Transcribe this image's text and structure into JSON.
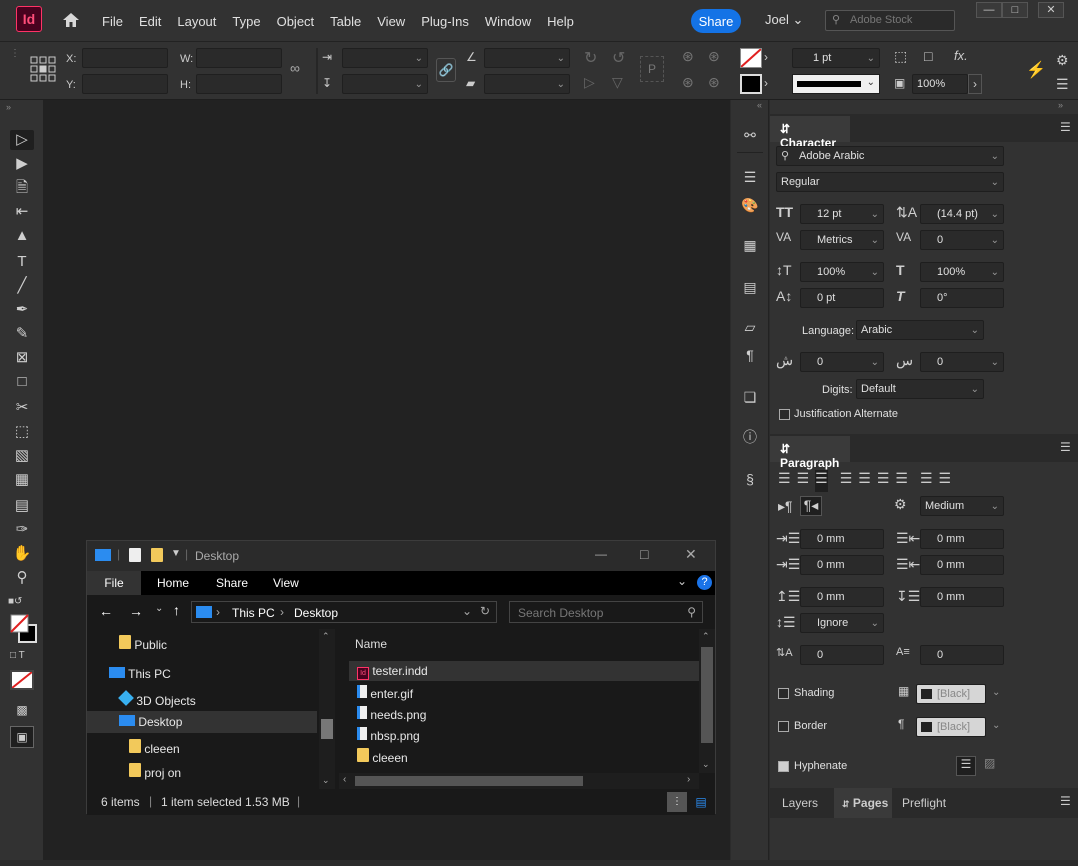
{
  "app": {
    "icon_text": "Id",
    "user": "Joel",
    "share_label": "Share",
    "stock_placeholder": "Adobe Stock"
  },
  "menu": [
    "File",
    "Edit",
    "Layout",
    "Type",
    "Object",
    "Table",
    "View",
    "Plug-Ins",
    "Window",
    "Help"
  ],
  "control_bar": {
    "x_label": "X:",
    "y_label": "Y:",
    "w_label": "W:",
    "h_label": "H:",
    "stroke_weight": "1 pt",
    "opacity": "100%"
  },
  "explorer": {
    "title": "Desktop",
    "ribbon_tabs": [
      "File",
      "Home",
      "Share",
      "View"
    ],
    "breadcrumb": [
      "This PC",
      "Desktop"
    ],
    "search_placeholder": "Search Desktop",
    "column_name": "Name",
    "tree": [
      {
        "label": "Public",
        "type": "folder"
      },
      {
        "label": "This PC",
        "type": "pc"
      },
      {
        "label": "3D Objects",
        "type": "objects"
      },
      {
        "label": "Desktop",
        "type": "desktop",
        "selected": true
      },
      {
        "label": "cleeen",
        "type": "folder"
      },
      {
        "label": "proj on",
        "type": "folder"
      }
    ],
    "files": [
      {
        "name": "tester.indd",
        "type": "indd",
        "selected": true
      },
      {
        "name": "enter.gif",
        "type": "img"
      },
      {
        "name": "needs.png",
        "type": "img"
      },
      {
        "name": "nbsp.png",
        "type": "img"
      },
      {
        "name": "cleeen",
        "type": "folder"
      }
    ],
    "status_count": "6 items",
    "status_selected": "1 item selected  1.53 MB"
  },
  "character": {
    "tab": "Character",
    "font_family": "Adobe Arabic",
    "font_style": "Regular",
    "font_size": "12 pt",
    "leading": "(14.4 pt)",
    "kerning": "Metrics",
    "tracking": "0",
    "vertical_scale": "100%",
    "horizontal_scale": "100%",
    "baseline_shift": "0 pt",
    "skew": "0°",
    "language_label": "Language:",
    "language": "Arabic",
    "diacritic1": "0",
    "diacritic2": "0",
    "digits_label": "Digits:",
    "digits": "Default",
    "justification_alternate": "Justification Alternate"
  },
  "paragraph": {
    "tab": "Paragraph",
    "kashida": "Medium",
    "left_indent": "0 mm",
    "right_indent": "0 mm",
    "first_line_indent": "0 mm",
    "last_line_indent": "0 mm",
    "space_before": "0 mm",
    "space_after": "0 mm",
    "align_to_grid": "Ignore",
    "drop_cap_lines": "0",
    "drop_cap_chars": "0",
    "shading_label": "Shading",
    "shading_color": "[Black]",
    "border_label": "Border",
    "border_color": "[Black]",
    "hyphenate_label": "Hyphenate"
  },
  "bottom_tabs": [
    "Layers",
    "Pages",
    "Preflight"
  ],
  "colors": {
    "accent": "#1473e6",
    "indesign": "#ff3366"
  }
}
